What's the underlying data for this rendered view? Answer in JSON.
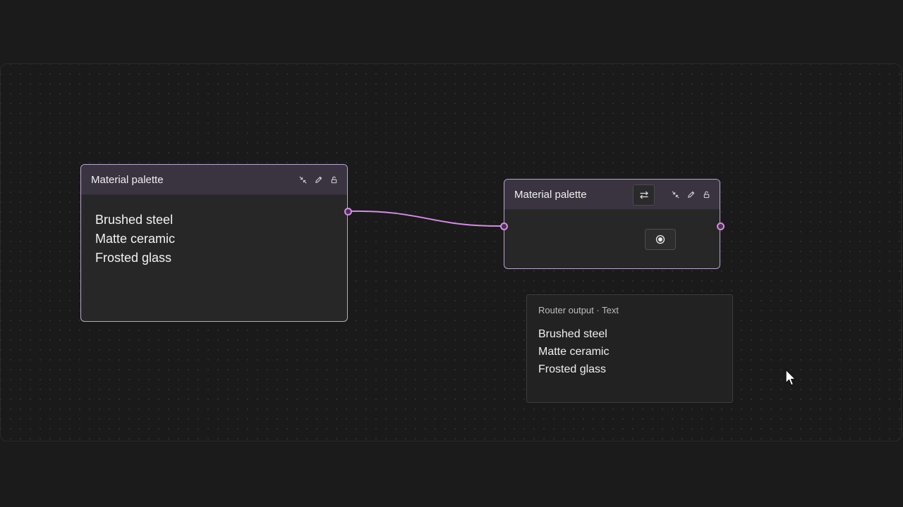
{
  "node_left": {
    "title": "Material palette",
    "items": [
      "Brushed steel",
      "Matte ceramic",
      "Frosted glass"
    ]
  },
  "node_right": {
    "title": "Material palette"
  },
  "output": {
    "caption": "Router output · Text",
    "items": [
      "Brushed steel",
      "Matte ceramic",
      "Frosted glass"
    ]
  },
  "colors": {
    "accent": "#d88be8",
    "node_border": "#b9a6d1",
    "header_bg": "#3a3441",
    "canvas_bg": "#1a1a1a"
  },
  "icons": {
    "collapse": "collapse-icon",
    "edit": "pencil-icon",
    "lock": "unlock-icon",
    "swap": "swap-arrows-icon",
    "radio": "radio-selected-icon"
  }
}
